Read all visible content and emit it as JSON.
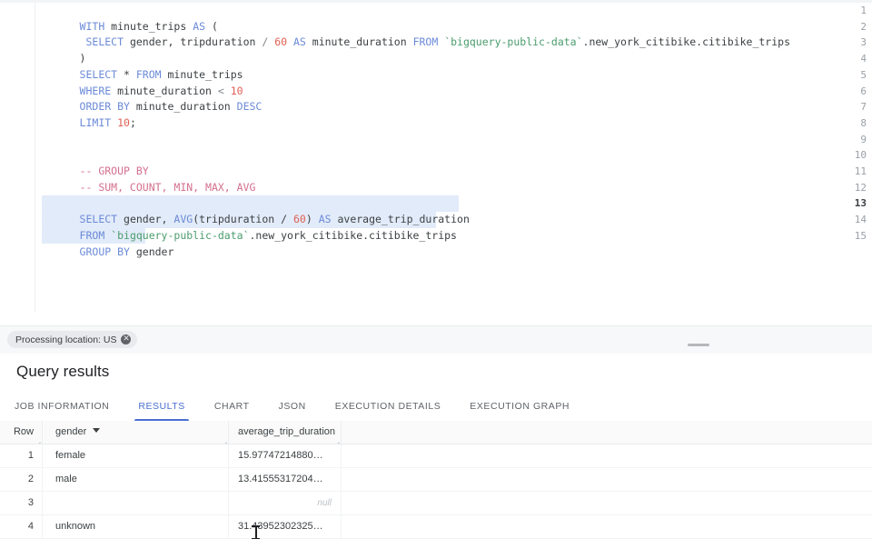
{
  "editor": {
    "lines": [
      {
        "n": "1",
        "selected": false,
        "active": false
      },
      {
        "n": "2",
        "selected": false,
        "active": false
      },
      {
        "n": "3",
        "selected": false,
        "active": false
      },
      {
        "n": "4",
        "selected": false,
        "active": false
      },
      {
        "n": "5",
        "selected": false,
        "active": false
      },
      {
        "n": "6",
        "selected": false,
        "active": false
      },
      {
        "n": "7",
        "selected": false,
        "active": false
      },
      {
        "n": "8",
        "selected": false,
        "active": false
      },
      {
        "n": "9",
        "selected": false,
        "active": false
      },
      {
        "n": "10",
        "selected": false,
        "active": false
      },
      {
        "n": "11",
        "selected": false,
        "active": false
      },
      {
        "n": "12",
        "selected": false,
        "active": false
      },
      {
        "n": "13",
        "selected": true,
        "active": true
      },
      {
        "n": "14",
        "selected": true,
        "active": false
      },
      {
        "n": "15",
        "selected": true,
        "active": false
      }
    ],
    "code": {
      "l1_with": "WITH",
      "l1_name": " minute_trips ",
      "l1_as": "AS",
      "l1_paren": " (",
      "l2_indent": " ",
      "l2_select": "SELECT",
      "l2_cols": " gender, tripduration ",
      "l2_slash": "/",
      "l2_60": " 60 ",
      "l2_as": "AS",
      "l2_alias": " minute_duration ",
      "l2_from": "FROM",
      "l2_project": " `bigquery-public-data`",
      "l2_table": ".new_york_citibike.citibike_trips",
      "l3_close": ")",
      "l4_select": "SELECT",
      "l4_star": " * ",
      "l4_from": "FROM",
      "l4_tbl": " minute_trips",
      "l5_where": "WHERE",
      "l5_col": " minute_duration ",
      "l5_lt": "<",
      "l5_num": " 10",
      "l6_order": "ORDER BY",
      "l6_col": " minute_duration ",
      "l6_desc": "DESC",
      "l7_limit": "LIMIT",
      "l7_num": " 10",
      "l7_semi": ";",
      "l10_comment": "-- GROUP BY",
      "l11_comment": "-- SUM, COUNT, MIN, MAX, AVG",
      "l13_select": "SELECT",
      "l13_gender": " gender, ",
      "l13_avg": "AVG",
      "l13_expr": "(tripduration / ",
      "l13_60": "60",
      "l13_close": ") ",
      "l13_as": "AS",
      "l13_alias": " average_trip_duration",
      "l14_from": "FROM",
      "l14_project": " `bigquery-public-data`",
      "l14_table": ".new_york_citibike.citibike_trips",
      "l15_groupby": "GROUP BY",
      "l15_col": " gender"
    }
  },
  "processing": {
    "chip_label": "Processing location: US",
    "chip_close_glyph": "✕"
  },
  "results": {
    "title": "Query results",
    "tabs": [
      {
        "label": "JOB INFORMATION",
        "active": false
      },
      {
        "label": "RESULTS",
        "active": true
      },
      {
        "label": "CHART",
        "active": false
      },
      {
        "label": "JSON",
        "active": false
      },
      {
        "label": "EXECUTION DETAILS",
        "active": false
      },
      {
        "label": "EXECUTION GRAPH",
        "active": false
      }
    ],
    "columns": {
      "row": "Row",
      "gender": "gender",
      "average": "average_trip_duration"
    },
    "rows": [
      {
        "row": "1",
        "gender": "female",
        "average": "15.97747214880…",
        "is_null": false
      },
      {
        "row": "2",
        "gender": "male",
        "average": "13.41555317204…",
        "is_null": false
      },
      {
        "row": "3",
        "gender": "",
        "average": "null",
        "is_null": true
      },
      {
        "row": "4",
        "gender": "unknown",
        "average": "31.43952302325…",
        "is_null": false
      }
    ]
  },
  "colors": {
    "accent": "#4a6fd0",
    "keyword": "#6b8ad8",
    "number": "#e06055",
    "string": "#4a9c6d",
    "comment": "#d4708f",
    "selection": "#d7e3f7"
  }
}
